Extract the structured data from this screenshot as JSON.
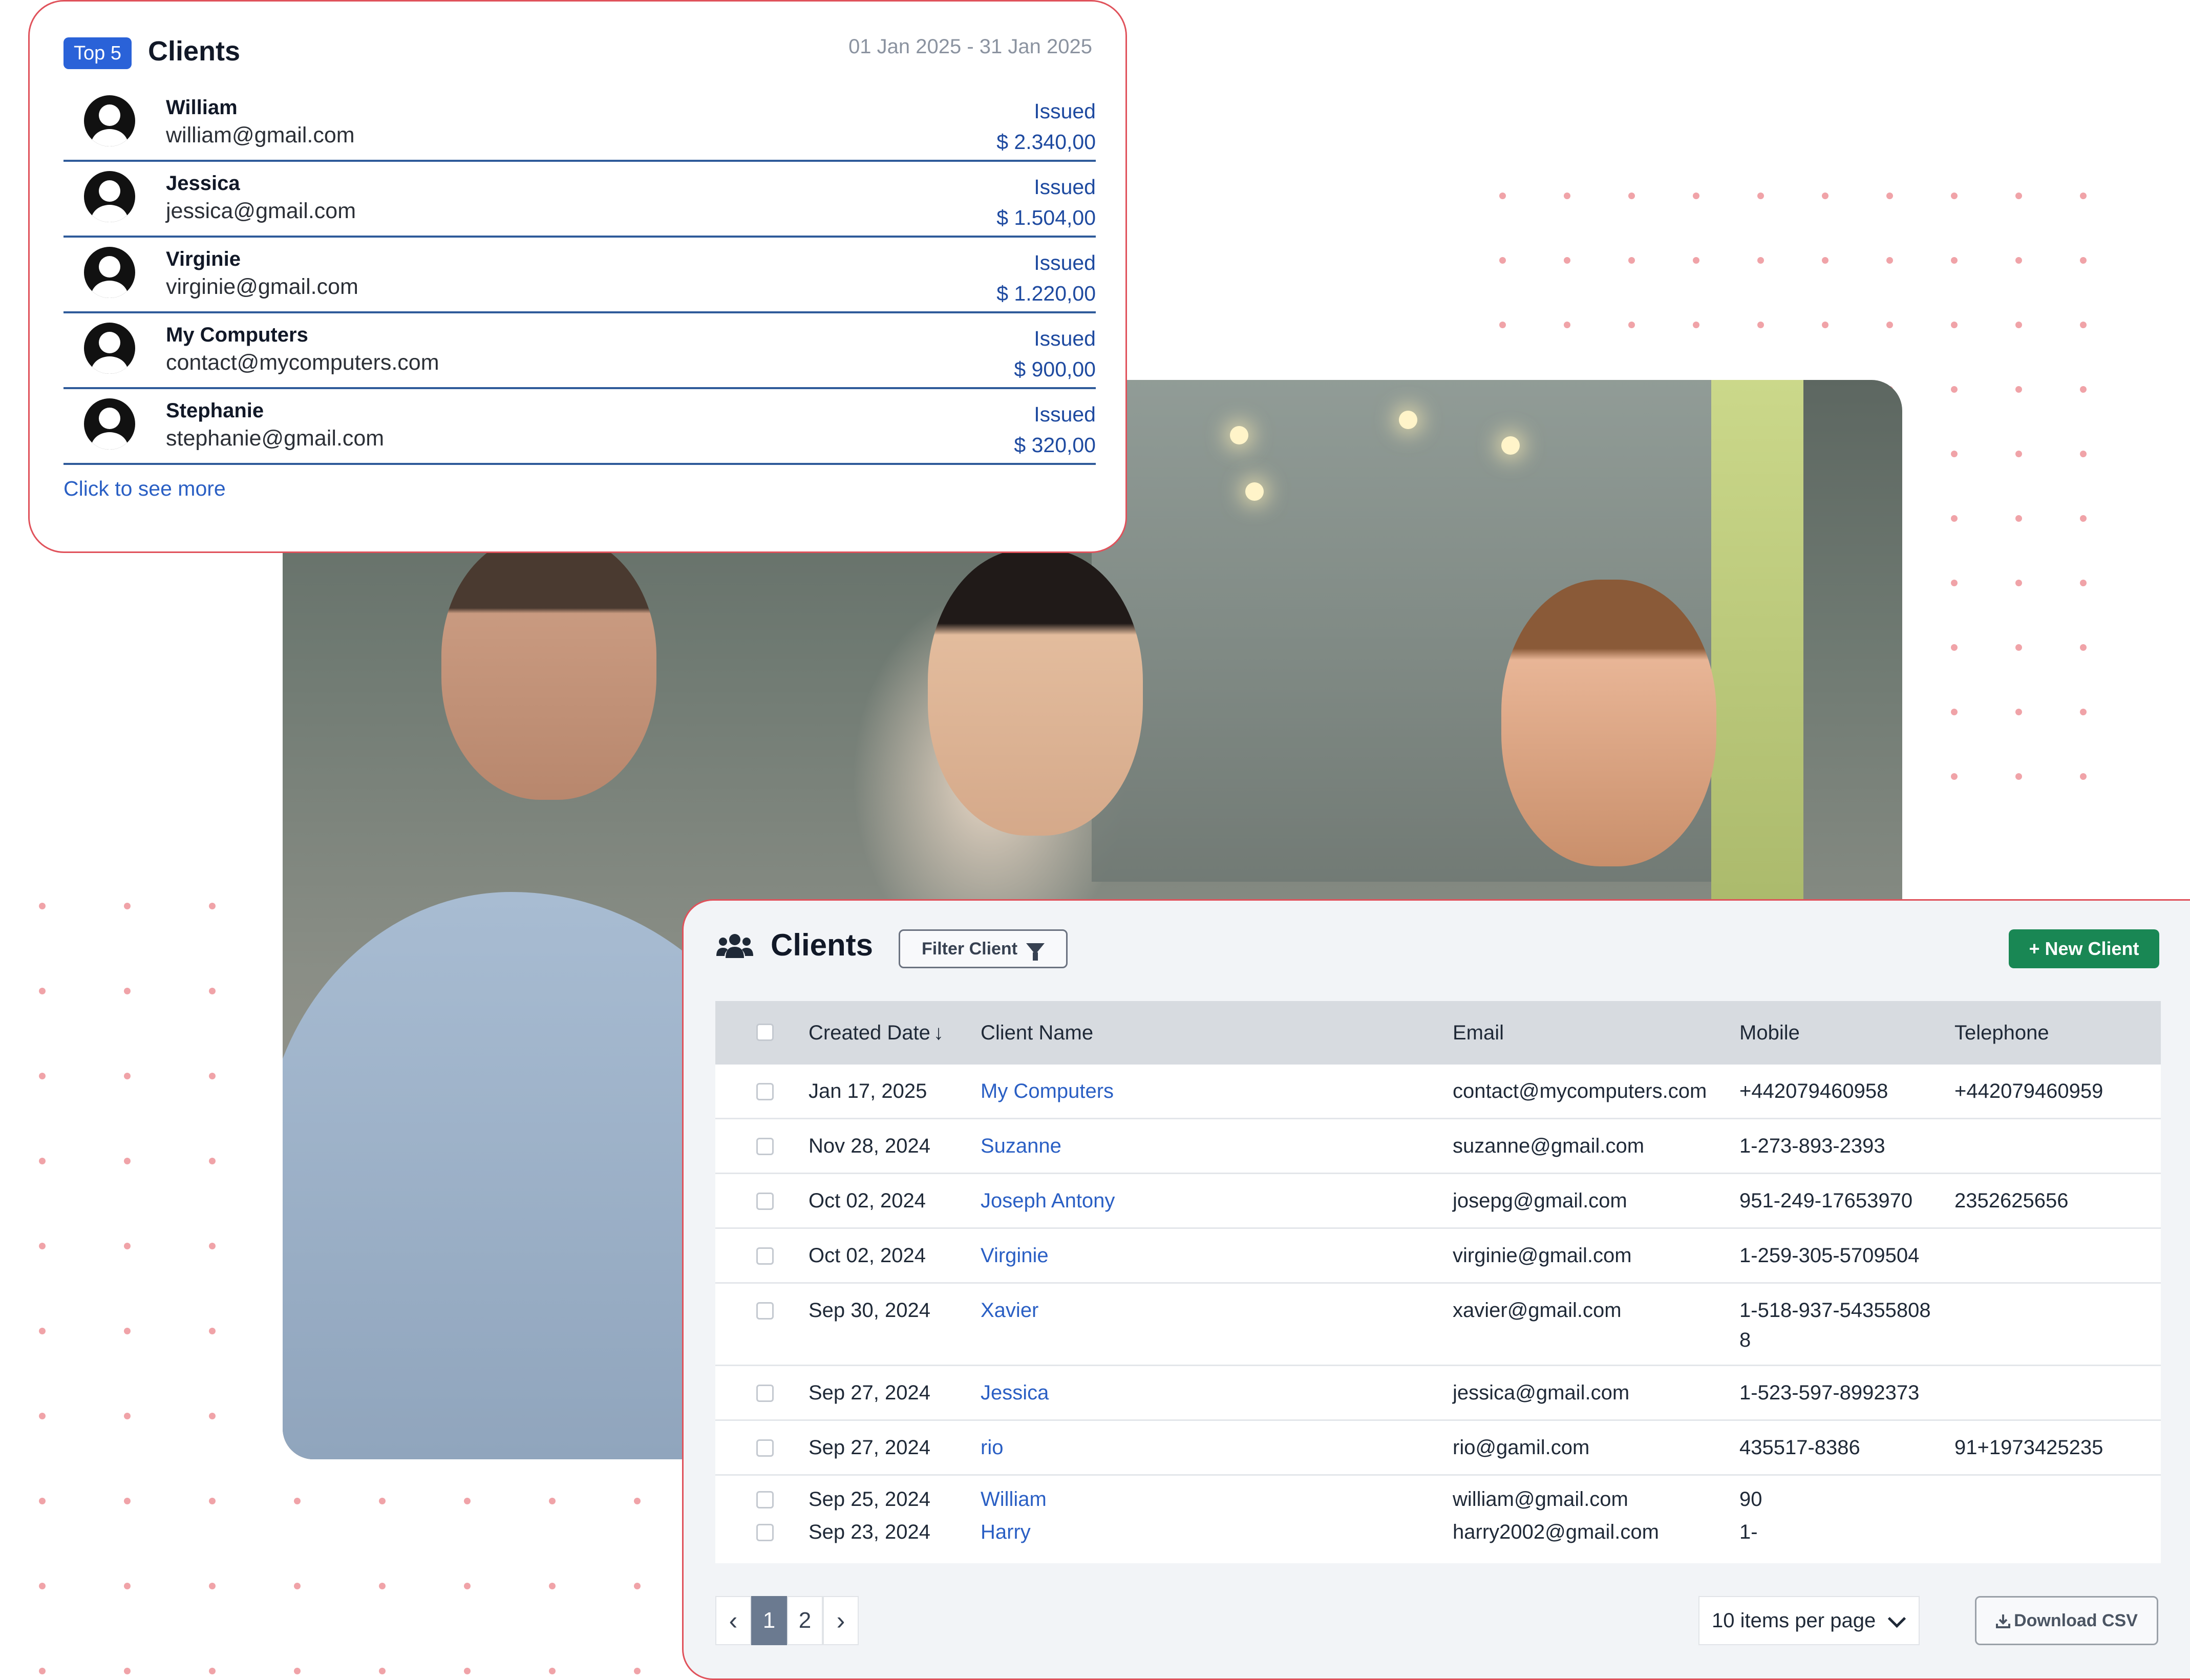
{
  "top_clients": {
    "badge": "Top 5",
    "title": "Clients",
    "date_range": "01 Jan 2025 - 31 Jan 2025",
    "rows": [
      {
        "name": "William",
        "email": "william@gmail.com",
        "status": "Issued",
        "amount": "$ 2.340,00"
      },
      {
        "name": "Jessica",
        "email": "jessica@gmail.com",
        "status": "Issued",
        "amount": "$ 1.504,00"
      },
      {
        "name": "Virginie",
        "email": "virginie@gmail.com",
        "status": "Issued",
        "amount": "$ 1.220,00"
      },
      {
        "name": "My Computers",
        "email": "contact@mycomputers.com",
        "status": "Issued",
        "amount": "$ 900,00"
      },
      {
        "name": "Stephanie",
        "email": "stephanie@gmail.com",
        "status": "Issued",
        "amount": "$ 320,00"
      }
    ],
    "see_more": "Click to see more"
  },
  "clients_panel": {
    "title": "Clients",
    "filter_label": "Filter Client",
    "new_label": "+ New Client",
    "columns": [
      "Created Date",
      "Client Name",
      "Email",
      "Mobile",
      "Telephone"
    ],
    "rows": [
      {
        "date": "Jan 17, 2025",
        "name": "My Computers",
        "email": "contact@mycomputers.com",
        "mobile": "+442079460958",
        "telephone": "+442079460959"
      },
      {
        "date": "Nov 28, 2024",
        "name": "Suzanne",
        "email": "suzanne@gmail.com",
        "mobile": "1-273-893-2393",
        "telephone": ""
      },
      {
        "date": "Oct 02, 2024",
        "name": "Joseph Antony",
        "email": "josepg@gmail.com",
        "mobile": "951-249-17653970",
        "telephone": "2352625656"
      },
      {
        "date": "Oct 02, 2024",
        "name": "Virginie",
        "email": "virginie@gmail.com",
        "mobile": "1-259-305-5709504",
        "telephone": ""
      },
      {
        "date": "Sep 30, 2024",
        "name": "Xavier",
        "email": "xavier@gmail.com",
        "mobile": "1-518-937-54355808",
        "mobile_wrap": "8",
        "telephone": ""
      },
      {
        "date": "Sep 27, 2024",
        "name": "Jessica",
        "email": "jessica@gmail.com",
        "mobile": "1-523-597-8992373",
        "telephone": ""
      },
      {
        "date": "Sep 27, 2024",
        "name": "rio",
        "email": "rio@gamil.com",
        "mobile": "435517-8386",
        "telephone": "91+1973425235"
      },
      {
        "date": "Sep 25, 2024",
        "name": "William",
        "email": "william@gmail.com",
        "mobile": "90",
        "telephone": ""
      },
      {
        "date": "Sep 23, 2024",
        "name": "Harry",
        "email": "harry2002@gmail.com",
        "mobile": "1-",
        "telephone": ""
      }
    ],
    "pagination": {
      "prev": "‹",
      "pages": [
        "1",
        "2"
      ],
      "current": "1",
      "next": "›"
    },
    "per_page": "10 items per page",
    "download_label": "Download CSV"
  },
  "colors": {
    "accent_blue": "#2a62d8",
    "link_blue": "#2a5fc4",
    "green": "#198754",
    "card_border": "#e0525b",
    "dots": "#f0a3a8"
  },
  "icons": [
    "user-avatar-icon",
    "users-group-icon",
    "funnel-icon",
    "sort-arrow-down-icon",
    "chevron-down-icon",
    "download-icon",
    "chevron-left-icon",
    "chevron-right-icon"
  ]
}
